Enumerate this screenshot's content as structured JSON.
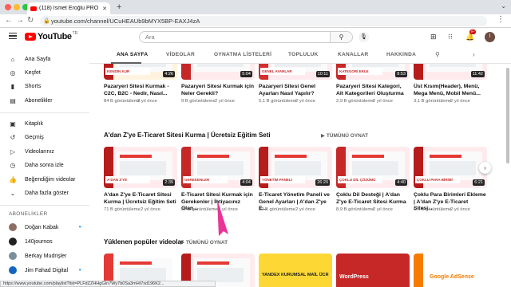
{
  "browser": {
    "tab_title": "(118) İsmet Eroğlu PRO - YouT",
    "url": "youtube.com/channel/UCuHEAUb9bMYX5BP-EAXJ4zA",
    "status_url": "https://www.youtube.com/playlist?list=PLFdZZHHgGIn7Wy7b0Sa3mHt7xd196K2..."
  },
  "header": {
    "logo_text": "YouTube",
    "logo_country": "TR",
    "search_placeholder": "Ara",
    "notif_count": "9+",
    "avatar_letter": "İ"
  },
  "sidebar": {
    "items": [
      {
        "icon": "home-icon",
        "glyph": "⌂",
        "label": "Ana Sayfa"
      },
      {
        "icon": "explore-icon",
        "glyph": "◎",
        "label": "Keşfet"
      },
      {
        "icon": "shorts-icon",
        "glyph": "▮",
        "label": "Shorts"
      },
      {
        "icon": "subscriptions-icon",
        "glyph": "▤",
        "label": "Abonelikler"
      },
      {
        "icon": "library-icon",
        "glyph": "▣",
        "label": "Kitaplık"
      },
      {
        "icon": "history-icon",
        "glyph": "↺",
        "label": "Geçmiş"
      },
      {
        "icon": "your-videos-icon",
        "glyph": "▷",
        "label": "Videolarınız"
      },
      {
        "icon": "watch-later-icon",
        "glyph": "◷",
        "label": "Daha sonra izle"
      },
      {
        "icon": "liked-videos-icon",
        "glyph": "👍",
        "label": "Beğendiğim videolar"
      },
      {
        "icon": "show-more-icon",
        "glyph": "⌄",
        "label": "Daha fazla göster"
      }
    ],
    "subs_header": "ABONELİKLER",
    "subs": [
      {
        "name": "Doğan Kabak",
        "color": "#8d6e63",
        "live": true
      },
      {
        "name": "140journos",
        "color": "#212121",
        "live": false
      },
      {
        "name": "Berkay Mudrişler",
        "color": "#78909c",
        "live": false
      },
      {
        "name": "Jim Fahad Digital",
        "color": "#1565c0",
        "live": true
      }
    ]
  },
  "channel_tabs": [
    "ANA SAYFA",
    "VİDEOLAR",
    "OYNATMA LİSTELERİ",
    "TOPLULUK",
    "KANALLAR",
    "HAKKINDA"
  ],
  "shelves": [
    {
      "title": "",
      "videos": [
        {
          "title": "Pazaryeri Sitesi Kurmak - C2C, B2C - Nedir, Nasıl...",
          "views": "84 B görüntüleme",
          "age": "2 yıl önce",
          "duration": "4:26",
          "ribbon": "KENDİN KUR",
          "bar": "#b71c1c"
        },
        {
          "title": "Pazaryeri Sitesi Kurmak için Neler Gerekli?",
          "views": "9 B görüntüleme",
          "age": "2 yıl önce",
          "duration": "5:04",
          "ribbon": "",
          "bar": "#c62828"
        },
        {
          "title": "Pazaryeri Sitesi Genel Ayarları Nasıl Yapılır?",
          "views": "5,1 B görüntüleme",
          "age": "2 yıl önce",
          "duration": "10:11",
          "ribbon": "GENEL AYARLAR",
          "bar": "#d32f2f"
        },
        {
          "title": "Pazaryeri Sitesi Kategori, Alt Kategorileri Oluşturma",
          "views": "2,9 B görüntüleme",
          "age": "2 yıl önce",
          "duration": "8:53",
          "ribbon": "KATEGORİ EKLE",
          "bar": "#c62828"
        },
        {
          "title": "Üst Kısım(Header), Menü, Mega Menü, Mobil Menü...",
          "views": "3,1 B görüntüleme",
          "age": "2 yıl önce",
          "duration": "11:42",
          "ribbon": "",
          "bar": "#b71c1c"
        }
      ]
    },
    {
      "title": "A'dan Z'ye E-Ticaret Sitesi Kurma | Ücretsiz Eğitim Seti",
      "play_all": "TÜMÜNÜ OYNAT",
      "videos": [
        {
          "title": "A'dan Z'ye E-Ticaret Sitesi Kurma | Ücretsiz Eğitim Seti",
          "views": "71 B görüntüleme",
          "age": "2 yıl önce",
          "duration": "2:39",
          "ribbon": "A'DAN Z'YE",
          "bar": "#b71c1c"
        },
        {
          "title": "E-Ticaret Sitesi Kurmak için Gerekenler | İhtiyacınız Olan...",
          "views": "27 B görüntüleme",
          "age": "2 yıl önce",
          "duration": "4:04",
          "ribbon": "GEREKENLER",
          "bar": "#c62828"
        },
        {
          "title": "E-Ticaret Yönetim Paneli ve Genel Ayarları | A'dan Z'ye E...",
          "views": "32 B görüntüleme",
          "age": "2 yıl önce",
          "duration": "26:20",
          "ribbon": "YÖNETİM PANELİ",
          "bar": "#b71c1c"
        },
        {
          "title": "Çoklu Dil Desteği | A'dan Z'ye E-Ticaret Sitesi Kurma",
          "views": "8,9 B görüntüleme",
          "age": "2 yıl önce",
          "duration": "4:40",
          "ribbon": "ÇOKLU DİL ÇÖZÜMÜ",
          "bar": "#c62828"
        },
        {
          "title": "Çoklu Para Birimleri Ekleme | A'dan Z'ye E-Ticaret Sitesi...",
          "views": "6,4 B görüntüleme",
          "age": "2 yıl önce",
          "duration": "6:21",
          "ribbon": "ÇOKLU PARA BİRİMİ",
          "bar": "#b71c1c"
        }
      ]
    },
    {
      "title": "Yüklenen popüler videolar",
      "play_all": "TÜMÜNÜ OYNAT",
      "videos": [
        {
          "title": "",
          "views": "",
          "age": "",
          "duration": "",
          "ribbon": "",
          "bar": "#e53935"
        },
        {
          "title": "",
          "views": "",
          "age": "",
          "duration": "",
          "ribbon": "",
          "bar": "#b71c1c"
        },
        {
          "title": "",
          "views": "",
          "age": "",
          "duration": "",
          "ribbon": "YANDEX KURUMSAL MAİL ÜCRETSİZ!",
          "bar": "#fdd835"
        },
        {
          "title": "",
          "views": "",
          "age": "",
          "duration": "",
          "ribbon": "WordPress",
          "bar": "#c62828"
        },
        {
          "title": "",
          "views": "",
          "age": "",
          "duration": "",
          "ribbon": "Google AdSense",
          "bar": "#f57c00"
        }
      ]
    }
  ],
  "colors": {
    "brand": "#ff0000",
    "link": "#3ea6ff",
    "text": "#0f0f0f",
    "muted": "#606060"
  }
}
